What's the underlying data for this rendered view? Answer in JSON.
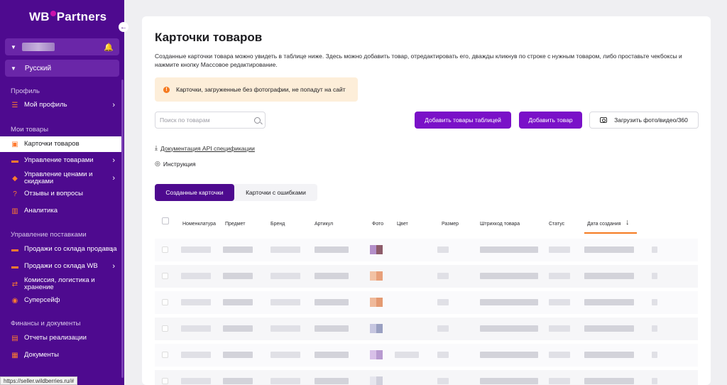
{
  "sidebar": {
    "logo_left": "WB",
    "logo_right": "Partners",
    "language": "Русский",
    "sections": {
      "profile": "Профиль",
      "my_goods": "Мои товары",
      "supplies": "Управление поставками",
      "finance": "Финансы и документы"
    },
    "items": {
      "my_profile": "Мой профиль",
      "cards": "Карточки товаров",
      "goods_mgmt": "Управление товарами",
      "prices_a": "Управление ценами и",
      "prices_b": "скидками",
      "reviews": "Отзывы и вопросы",
      "analytics": "Аналитика",
      "seller_stock": "Продажи со склада продавца",
      "wb_stock": "Продажи со склада WB",
      "commission_a": "Комиссия, логистика и",
      "commission_b": "хранение",
      "supersafe": "Суперсейф",
      "reports": "Отчеты реализации",
      "documents": "Документы"
    },
    "status_url": "https://seller.wildberries.ru/#"
  },
  "main": {
    "title": "Карточки товаров",
    "description": "Созданные карточки товара можно увидеть в таблице ниже. Здесь можно добавить товар, отредактировать его, дважды кликнув по строке с нужным товаром, либо проставьте чекбоксы и нажмите кнопку Массовое редактирование.",
    "warning": "Карточки, загруженные без фотографии, не попадут на сайт",
    "search_placeholder": "Поиск по товарам",
    "btn_add_table": "Добавить товары таблицей",
    "btn_add": "Добавить товар",
    "btn_upload": "Загрузить фото/видео/360",
    "link_api": "Документация API спецификации",
    "link_instruction": "Инструкция",
    "tab_created": "Созданные карточки",
    "tab_errors": "Карточки с ошибками",
    "columns": {
      "nomenclature": "Номенклатура",
      "subject": "Предмет",
      "brand": "Бренд",
      "article": "Артикул",
      "photo": "Фото",
      "color": "Цвет",
      "size": "Размер",
      "barcode": "Штрихкод товара",
      "status": "Статус",
      "created": "Дата создания"
    }
  },
  "colors": {
    "sidebar": "#4e0a8f",
    "accent_orange": "#f57a20",
    "button_purple": "#7a11c8"
  }
}
